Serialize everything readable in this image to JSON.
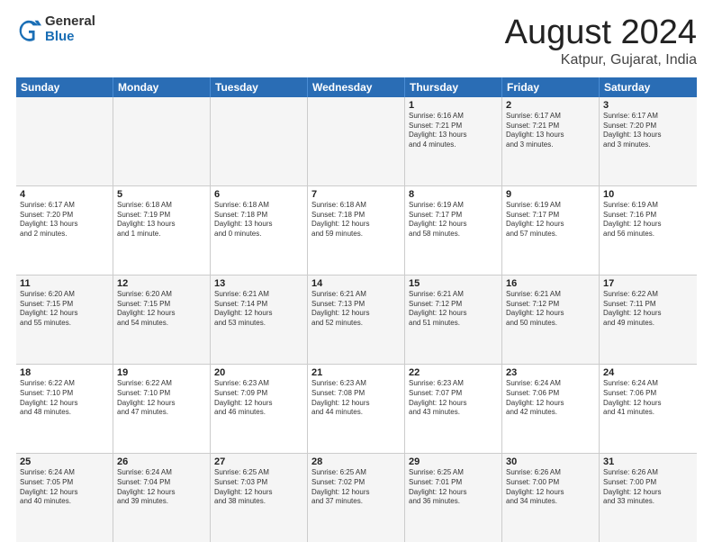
{
  "logo": {
    "general": "General",
    "blue": "Blue"
  },
  "header": {
    "month": "August 2024",
    "location": "Katpur, Gujarat, India"
  },
  "weekdays": [
    "Sunday",
    "Monday",
    "Tuesday",
    "Wednesday",
    "Thursday",
    "Friday",
    "Saturday"
  ],
  "weeks": [
    [
      {
        "day": "",
        "info": ""
      },
      {
        "day": "",
        "info": ""
      },
      {
        "day": "",
        "info": ""
      },
      {
        "day": "",
        "info": ""
      },
      {
        "day": "1",
        "info": "Sunrise: 6:16 AM\nSunset: 7:21 PM\nDaylight: 13 hours\nand 4 minutes."
      },
      {
        "day": "2",
        "info": "Sunrise: 6:17 AM\nSunset: 7:21 PM\nDaylight: 13 hours\nand 3 minutes."
      },
      {
        "day": "3",
        "info": "Sunrise: 6:17 AM\nSunset: 7:20 PM\nDaylight: 13 hours\nand 3 minutes."
      }
    ],
    [
      {
        "day": "4",
        "info": "Sunrise: 6:17 AM\nSunset: 7:20 PM\nDaylight: 13 hours\nand 2 minutes."
      },
      {
        "day": "5",
        "info": "Sunrise: 6:18 AM\nSunset: 7:19 PM\nDaylight: 13 hours\nand 1 minute."
      },
      {
        "day": "6",
        "info": "Sunrise: 6:18 AM\nSunset: 7:18 PM\nDaylight: 13 hours\nand 0 minutes."
      },
      {
        "day": "7",
        "info": "Sunrise: 6:18 AM\nSunset: 7:18 PM\nDaylight: 12 hours\nand 59 minutes."
      },
      {
        "day": "8",
        "info": "Sunrise: 6:19 AM\nSunset: 7:17 PM\nDaylight: 12 hours\nand 58 minutes."
      },
      {
        "day": "9",
        "info": "Sunrise: 6:19 AM\nSunset: 7:17 PM\nDaylight: 12 hours\nand 57 minutes."
      },
      {
        "day": "10",
        "info": "Sunrise: 6:19 AM\nSunset: 7:16 PM\nDaylight: 12 hours\nand 56 minutes."
      }
    ],
    [
      {
        "day": "11",
        "info": "Sunrise: 6:20 AM\nSunset: 7:15 PM\nDaylight: 12 hours\nand 55 minutes."
      },
      {
        "day": "12",
        "info": "Sunrise: 6:20 AM\nSunset: 7:15 PM\nDaylight: 12 hours\nand 54 minutes."
      },
      {
        "day": "13",
        "info": "Sunrise: 6:21 AM\nSunset: 7:14 PM\nDaylight: 12 hours\nand 53 minutes."
      },
      {
        "day": "14",
        "info": "Sunrise: 6:21 AM\nSunset: 7:13 PM\nDaylight: 12 hours\nand 52 minutes."
      },
      {
        "day": "15",
        "info": "Sunrise: 6:21 AM\nSunset: 7:12 PM\nDaylight: 12 hours\nand 51 minutes."
      },
      {
        "day": "16",
        "info": "Sunrise: 6:21 AM\nSunset: 7:12 PM\nDaylight: 12 hours\nand 50 minutes."
      },
      {
        "day": "17",
        "info": "Sunrise: 6:22 AM\nSunset: 7:11 PM\nDaylight: 12 hours\nand 49 minutes."
      }
    ],
    [
      {
        "day": "18",
        "info": "Sunrise: 6:22 AM\nSunset: 7:10 PM\nDaylight: 12 hours\nand 48 minutes."
      },
      {
        "day": "19",
        "info": "Sunrise: 6:22 AM\nSunset: 7:10 PM\nDaylight: 12 hours\nand 47 minutes."
      },
      {
        "day": "20",
        "info": "Sunrise: 6:23 AM\nSunset: 7:09 PM\nDaylight: 12 hours\nand 46 minutes."
      },
      {
        "day": "21",
        "info": "Sunrise: 6:23 AM\nSunset: 7:08 PM\nDaylight: 12 hours\nand 44 minutes."
      },
      {
        "day": "22",
        "info": "Sunrise: 6:23 AM\nSunset: 7:07 PM\nDaylight: 12 hours\nand 43 minutes."
      },
      {
        "day": "23",
        "info": "Sunrise: 6:24 AM\nSunset: 7:06 PM\nDaylight: 12 hours\nand 42 minutes."
      },
      {
        "day": "24",
        "info": "Sunrise: 6:24 AM\nSunset: 7:06 PM\nDaylight: 12 hours\nand 41 minutes."
      }
    ],
    [
      {
        "day": "25",
        "info": "Sunrise: 6:24 AM\nSunset: 7:05 PM\nDaylight: 12 hours\nand 40 minutes."
      },
      {
        "day": "26",
        "info": "Sunrise: 6:24 AM\nSunset: 7:04 PM\nDaylight: 12 hours\nand 39 minutes."
      },
      {
        "day": "27",
        "info": "Sunrise: 6:25 AM\nSunset: 7:03 PM\nDaylight: 12 hours\nand 38 minutes."
      },
      {
        "day": "28",
        "info": "Sunrise: 6:25 AM\nSunset: 7:02 PM\nDaylight: 12 hours\nand 37 minutes."
      },
      {
        "day": "29",
        "info": "Sunrise: 6:25 AM\nSunset: 7:01 PM\nDaylight: 12 hours\nand 36 minutes."
      },
      {
        "day": "30",
        "info": "Sunrise: 6:26 AM\nSunset: 7:00 PM\nDaylight: 12 hours\nand 34 minutes."
      },
      {
        "day": "31",
        "info": "Sunrise: 6:26 AM\nSunset: 7:00 PM\nDaylight: 12 hours\nand 33 minutes."
      }
    ]
  ]
}
